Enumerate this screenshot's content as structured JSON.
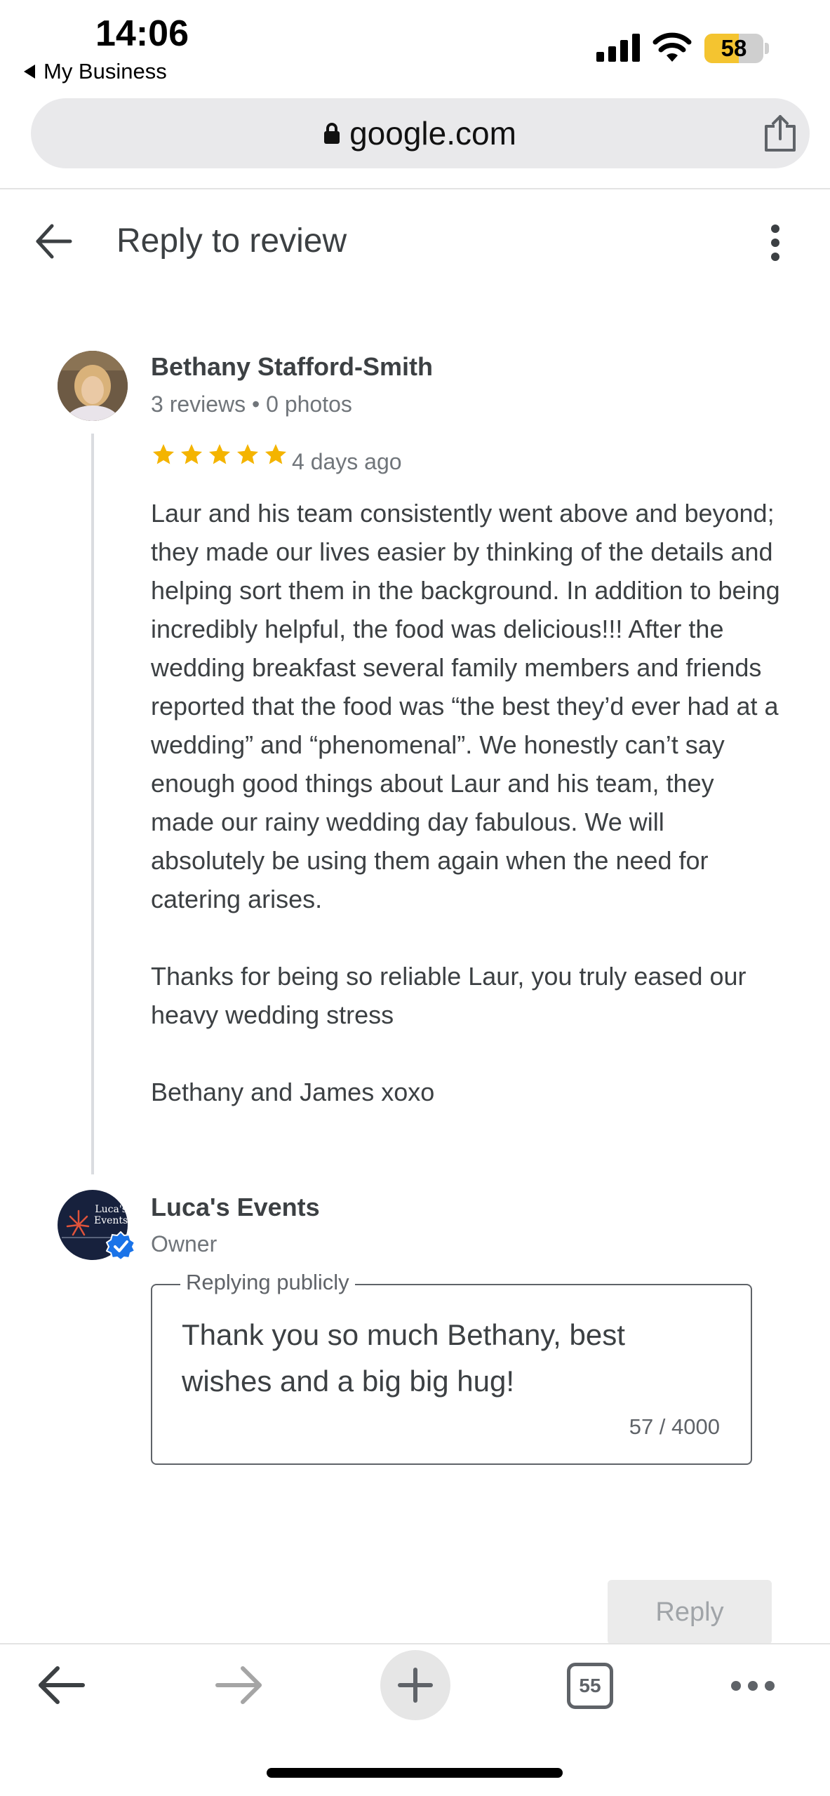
{
  "status_bar": {
    "time": "14:06",
    "back_app_label": "My Business",
    "battery_level": "58",
    "battery_fraction": 0.58
  },
  "browser": {
    "url": "google.com",
    "open_tabs": "55"
  },
  "header": {
    "title": "Reply to review"
  },
  "review": {
    "reviewer_name": "Bethany Stafford-Smith",
    "reviewer_meta": "3 reviews • 0 photos",
    "rating": 5,
    "max_rating": 5,
    "date": "4 days ago",
    "paragraphs": [
      "Laur and his team consistently went above and beyond; they made our lives easier by thinking of the details and helping sort them in the background. In addition to being incredibly helpful, the food was delicious!!! After the wedding breakfast several family members and friends reported that the food was “the best they’d ever had at a wedding” and “phenomenal”. We honestly can’t say enough good things about Laur and his team, they made our rainy wedding day fabulous. We will absolutely be using them again when the need for catering arises.",
      "Thanks for being so reliable Laur, you truly eased our heavy wedding stress",
      "Bethany and James xoxo"
    ]
  },
  "owner": {
    "name": "Luca's Events",
    "role": "Owner",
    "logo_line1": "Luca's",
    "logo_line2": "Events"
  },
  "reply": {
    "field_label": "Replying publicly",
    "text": "Thank you so much Bethany, best wishes and a big big hug!",
    "char_count": "57 / 4000",
    "button_label": "Reply"
  },
  "colors": {
    "star": "#f4b400",
    "verified": "#1a73e8",
    "battery": "#f4c430"
  }
}
